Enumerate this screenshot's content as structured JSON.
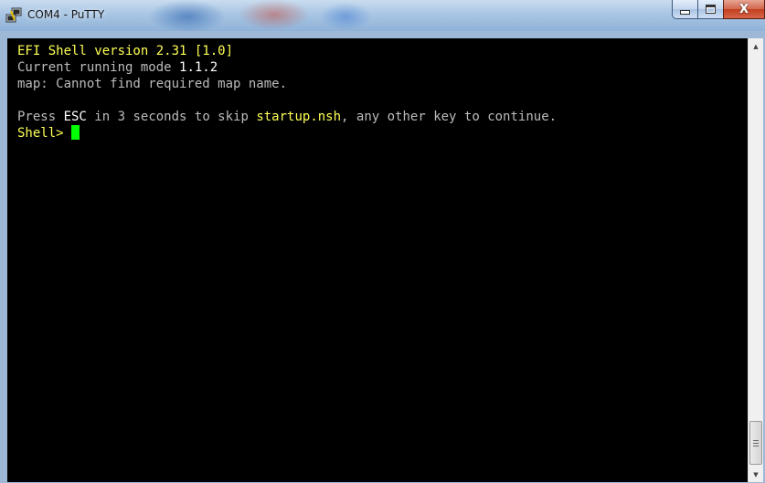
{
  "window": {
    "title": "COM4 - PuTTY",
    "minimize_symbol": "",
    "maximize_symbol": "",
    "close_symbol": "X"
  },
  "terminal": {
    "line1": "EFI Shell version 2.31 [1.0]",
    "line2_prefix": "Current running mode ",
    "line2_version": "1.1.2",
    "line3": "map: Cannot find required map name.",
    "line4_blank": "",
    "line5_p1": "Press ",
    "line5_esc": "ESC",
    "line5_p2": " in ",
    "line5_num": "3",
    "line5_p3": " seconds to skip ",
    "line5_file": "startup.nsh",
    "line5_p4": ", any other key to continue.",
    "prompt": "Shell> "
  },
  "colors": {
    "background": "#000000",
    "text_gray": "#bbbbbb",
    "text_yellow": "#ffff55",
    "text_white": "#ffffff",
    "cursor": "#00ff00"
  }
}
